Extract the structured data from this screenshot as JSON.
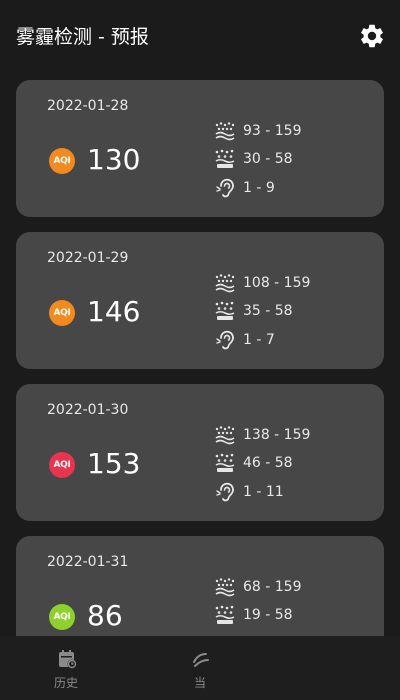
{
  "header": {
    "title": "雾霾检测 - 预报",
    "settings_icon": "gear-icon"
  },
  "colors": {
    "background": "#1b1b1b",
    "card": "#474747",
    "aqi_orange": "#f28a1e",
    "aqi_red": "#e8344e",
    "aqi_green": "#8fd12c"
  },
  "forecast": [
    {
      "date": "2022-01-28",
      "aqi_badge": "AQI",
      "aqi": "130",
      "aqi_color": "#f28a1e",
      "pm10": "93 - 159",
      "pm25": "30 - 58",
      "other": "1 - 9"
    },
    {
      "date": "2022-01-29",
      "aqi_badge": "AQI",
      "aqi": "146",
      "aqi_color": "#f28a1e",
      "pm10": "108 - 159",
      "pm25": "35 - 58",
      "other": "1 - 7"
    },
    {
      "date": "2022-01-30",
      "aqi_badge": "AQI",
      "aqi": "153",
      "aqi_color": "#e8344e",
      "pm10": "138 - 159",
      "pm25": "46 - 58",
      "other": "1 - 11"
    },
    {
      "date": "2022-01-31",
      "aqi_badge": "AQI",
      "aqi": "86",
      "aqi_color": "#8fd12c",
      "pm10": "68 - 159",
      "pm25": "19 - 58",
      "other": ""
    }
  ],
  "bottom_nav": {
    "history_label": "历史",
    "history_icon": "calendar-history-icon",
    "current_label": "当",
    "current_icon": "current-air-icon"
  }
}
